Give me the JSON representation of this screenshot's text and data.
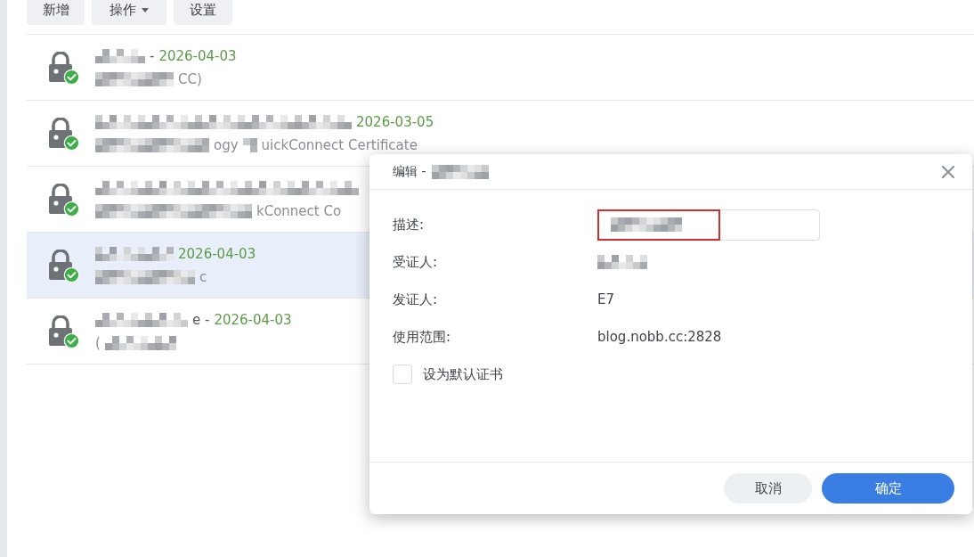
{
  "toolbar": {
    "buttons": [
      {
        "label": "新增",
        "kind": "button"
      },
      {
        "label": "操作",
        "kind": "dropdown"
      },
      {
        "label": "设置",
        "kind": "button"
      }
    ]
  },
  "certificates": [
    {
      "title": [
        {
          "kind": "blur"
        },
        {
          "kind": "text",
          "text": "-"
        },
        {
          "kind": "date",
          "text": "2026-04-03"
        }
      ],
      "subtitle": [
        {
          "kind": "blur"
        },
        {
          "kind": "text",
          "text": "CC)"
        }
      ],
      "selected": false
    },
    {
      "title": [
        {
          "kind": "blur"
        },
        {
          "kind": "date",
          "text": "2026-03-05"
        }
      ],
      "subtitle": [
        {
          "kind": "blur"
        },
        {
          "kind": "text",
          "text": "ogy"
        },
        {
          "kind": "blur"
        },
        {
          "kind": "text",
          "text": "uickConnect Certificate"
        }
      ],
      "selected": false
    },
    {
      "title": [
        {
          "kind": "blur"
        }
      ],
      "subtitle": [
        {
          "kind": "blur"
        },
        {
          "kind": "text",
          "text": "kConnect Co"
        }
      ],
      "selected": false
    },
    {
      "title": [
        {
          "kind": "blur"
        },
        {
          "kind": "date",
          "text": "2026-04-03"
        }
      ],
      "subtitle": [
        {
          "kind": "blur"
        },
        {
          "kind": "text",
          "text": "c"
        }
      ],
      "selected": true
    },
    {
      "title": [
        {
          "kind": "blur"
        },
        {
          "kind": "text",
          "text": "e -"
        },
        {
          "kind": "date",
          "text": "2026-04-03"
        }
      ],
      "subtitle": [
        {
          "kind": "text",
          "text": "("
        },
        {
          "kind": "blur"
        }
      ],
      "selected": false
    }
  ],
  "dialog": {
    "title_prefix": "编辑 -",
    "fields": [
      {
        "kind": "input",
        "label": "描述:",
        "annotated": true
      },
      {
        "kind": "redacted",
        "label": "受证人:"
      },
      {
        "kind": "text",
        "label": "发证人:",
        "value": "E7"
      },
      {
        "kind": "text",
        "label": "使用范围:",
        "value": "blog.nobb.cc:2828"
      }
    ],
    "default_checkbox": {
      "label": "设为默认证书",
      "checked": false
    },
    "buttons": [
      {
        "label": "取消",
        "kind": "secondary"
      },
      {
        "label": "确定",
        "kind": "primary"
      }
    ]
  }
}
